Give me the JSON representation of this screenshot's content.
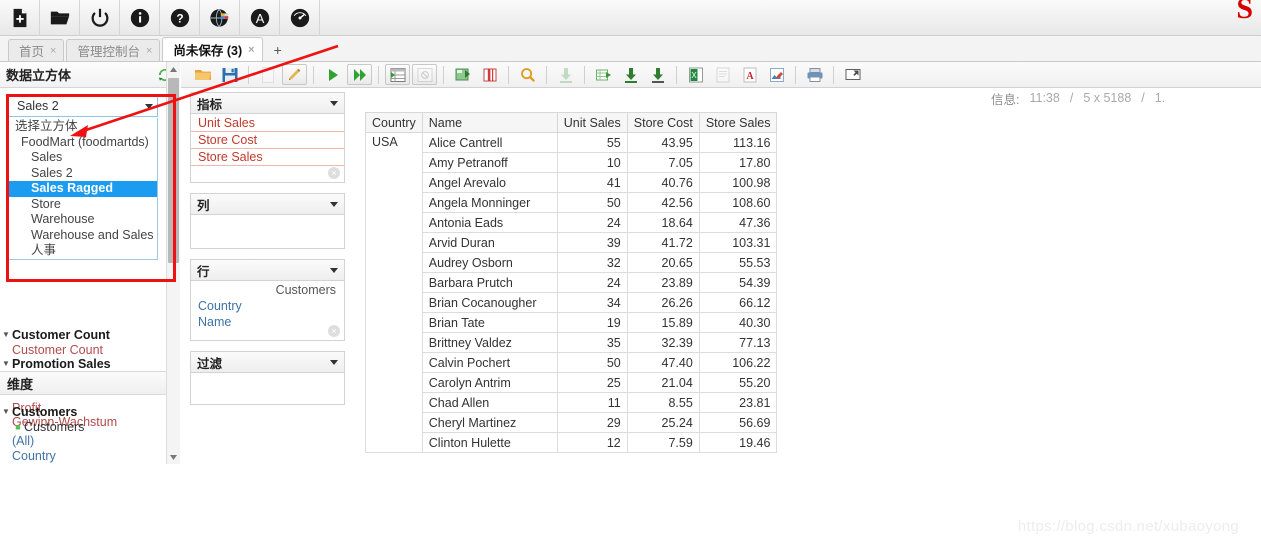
{
  "window": {
    "brand_mark": "S",
    "watermark": "https://blog.csdn.net/xubaoyong"
  },
  "topbar": {
    "buttons": [
      {
        "name": "new-file-icon",
        "label": "新建"
      },
      {
        "name": "open-folder-icon",
        "label": "打开"
      },
      {
        "name": "power-icon",
        "label": "退出"
      },
      {
        "name": "info-icon",
        "label": "关于"
      },
      {
        "name": "help-icon",
        "label": "帮助"
      },
      {
        "name": "globe-language-icon",
        "label": "语言"
      },
      {
        "name": "font-icon",
        "label": "字体"
      },
      {
        "name": "gauge-icon",
        "label": "性能"
      }
    ]
  },
  "tabs": {
    "items": [
      {
        "label": "首页",
        "close": "×",
        "active": false
      },
      {
        "label": "管理控制台",
        "close": "×",
        "active": false
      },
      {
        "label": "尚未保存 (3)",
        "close": "×",
        "active": true
      }
    ],
    "add_label": "+"
  },
  "left_panel": {
    "title": "数据立方体",
    "refresh_icon": "refresh-icon",
    "cube_select": {
      "value": "Sales 2",
      "caret": "chevron-down-icon",
      "options": [
        {
          "label": "选择立方体",
          "level": 0,
          "selected": false
        },
        {
          "label": "FoodMart (foodmartds)",
          "level": 1,
          "selected": false
        },
        {
          "label": "Sales",
          "level": 2,
          "selected": false
        },
        {
          "label": "Sales 2",
          "level": 2,
          "selected": false
        },
        {
          "label": "Sales Ragged",
          "level": 2,
          "selected": true
        },
        {
          "label": "Store",
          "level": 2,
          "selected": false
        },
        {
          "label": "Warehouse",
          "level": 2,
          "selected": false
        },
        {
          "label": "Warehouse and Sales",
          "level": 2,
          "selected": false
        },
        {
          "label": "人事",
          "level": 2,
          "selected": false
        }
      ]
    },
    "measure_tree": [
      {
        "label": "Customer Count",
        "type": "folder"
      },
      {
        "label": "Customer Count",
        "type": "measure"
      },
      {
        "label": "Promotion Sales",
        "type": "folder"
      },
      {
        "label": "Promotion Sales",
        "type": "measure"
      },
      {
        "label": "",
        "type": "folder"
      },
      {
        "label": "Profit",
        "type": "measure"
      },
      {
        "label": "Gewinn-Wachstum",
        "type": "measure"
      }
    ],
    "dimension_section_title": "维度",
    "dimension_tree": [
      {
        "label": "Customers",
        "type": "dim-folder"
      },
      {
        "label": "Customers",
        "type": "dim-hierarchy"
      },
      {
        "label": "(All)",
        "type": "dim-level"
      },
      {
        "label": "Country",
        "type": "dim-level"
      }
    ]
  },
  "query_toolbar": {
    "buttons": [
      {
        "name": "open-query-icon",
        "label": "打开"
      },
      {
        "name": "save-query-icon",
        "label": "保存"
      },
      {
        "name": "new-query-icon",
        "label": "新建查询",
        "disabled": true
      },
      {
        "name": "edit-mdx-icon",
        "label": "编辑 MDX"
      },
      {
        "name": "run-icon",
        "label": "执行"
      },
      {
        "name": "auto-run-icon",
        "label": "自动执行"
      },
      {
        "name": "toggle-fields-icon",
        "label": "显示字段"
      },
      {
        "name": "hide-empty-icon",
        "label": "隐藏空行",
        "disabled": true
      },
      {
        "name": "swap-axes-icon",
        "label": "交换坐标轴"
      },
      {
        "name": "drill-icon",
        "label": "钻取"
      },
      {
        "name": "zoom-icon",
        "label": "缩放"
      },
      {
        "name": "export-down-icon",
        "label": "导出",
        "disabled": true
      },
      {
        "name": "table-export-icon",
        "label": "表格导出"
      },
      {
        "name": "download-icon",
        "label": "下载"
      },
      {
        "name": "download-alt-icon",
        "label": "下载全部"
      },
      {
        "name": "export-xls-icon",
        "label": "导出 Excel"
      },
      {
        "name": "export-doc-icon",
        "label": "导出文档",
        "disabled": true
      },
      {
        "name": "export-pdf-icon",
        "label": "导出 PDF"
      },
      {
        "name": "chart-edit-icon",
        "label": "图表编辑"
      },
      {
        "name": "print-icon",
        "label": "打印"
      },
      {
        "name": "fullscreen-icon",
        "label": "全屏"
      }
    ]
  },
  "info_bar": {
    "label": "信息:",
    "time": "11:38",
    "sep1": "/",
    "size": "5 x 5188",
    "sep2": "/",
    "extra": "1."
  },
  "axis_panels": [
    {
      "key": "measures",
      "title": "指标",
      "caret": "chevron-down-icon",
      "chips": [
        "Unit Sales",
        "Store Cost",
        "Store Sales"
      ],
      "chip_style": "measure",
      "has_clear": true
    },
    {
      "key": "columns",
      "title": "列",
      "caret": "chevron-down-icon",
      "chips": [],
      "chip_style": "dimension",
      "has_clear": false
    },
    {
      "key": "rows",
      "title": "行",
      "caret": "chevron-down-icon",
      "header_chip": "Customers",
      "chips": [
        "Country",
        "Name"
      ],
      "chip_style": "dimension",
      "has_clear": true
    },
    {
      "key": "filter",
      "title": "过滤",
      "caret": "chevron-down-icon",
      "chips": [],
      "chip_style": "dimension",
      "has_clear": false
    }
  ],
  "pivot_table": {
    "headers": [
      "Country",
      "Name",
      "Unit Sales",
      "Store Cost",
      "Store Sales"
    ],
    "country_value": "USA",
    "rows": [
      {
        "name": "Alice Cantrell",
        "unit_sales": "55",
        "store_cost": "43.95",
        "store_sales": "113.16"
      },
      {
        "name": "Amy Petranoff",
        "unit_sales": "10",
        "store_cost": "7.05",
        "store_sales": "17.80"
      },
      {
        "name": "Angel Arevalo",
        "unit_sales": "41",
        "store_cost": "40.76",
        "store_sales": "100.98"
      },
      {
        "name": "Angela Monninger",
        "unit_sales": "50",
        "store_cost": "42.56",
        "store_sales": "108.60"
      },
      {
        "name": "Antonia Eads",
        "unit_sales": "24",
        "store_cost": "18.64",
        "store_sales": "47.36"
      },
      {
        "name": "Arvid Duran",
        "unit_sales": "39",
        "store_cost": "41.72",
        "store_sales": "103.31"
      },
      {
        "name": "Audrey Osborn",
        "unit_sales": "32",
        "store_cost": "20.65",
        "store_sales": "55.53"
      },
      {
        "name": "Barbara Prutch",
        "unit_sales": "24",
        "store_cost": "23.89",
        "store_sales": "54.39"
      },
      {
        "name": "Brian Cocanougher",
        "unit_sales": "34",
        "store_cost": "26.26",
        "store_sales": "66.12"
      },
      {
        "name": "Brian Tate",
        "unit_sales": "19",
        "store_cost": "15.89",
        "store_sales": "40.30"
      },
      {
        "name": "Brittney Valdez",
        "unit_sales": "35",
        "store_cost": "32.39",
        "store_sales": "77.13"
      },
      {
        "name": "Calvin Pochert",
        "unit_sales": "50",
        "store_cost": "47.40",
        "store_sales": "106.22"
      },
      {
        "name": "Carolyn Antrim",
        "unit_sales": "25",
        "store_cost": "21.04",
        "store_sales": "55.20"
      },
      {
        "name": "Chad Allen",
        "unit_sales": "11",
        "store_cost": "8.55",
        "store_sales": "23.81"
      },
      {
        "name": "Cheryl Martinez",
        "unit_sales": "29",
        "store_cost": "25.24",
        "store_sales": "56.69"
      },
      {
        "name": "Clinton Hulette",
        "unit_sales": "12",
        "store_cost": "7.59",
        "store_sales": "19.46"
      }
    ]
  },
  "annotations": {
    "highlight_color": "#ee1111",
    "arrow_color": "#ee1111"
  }
}
